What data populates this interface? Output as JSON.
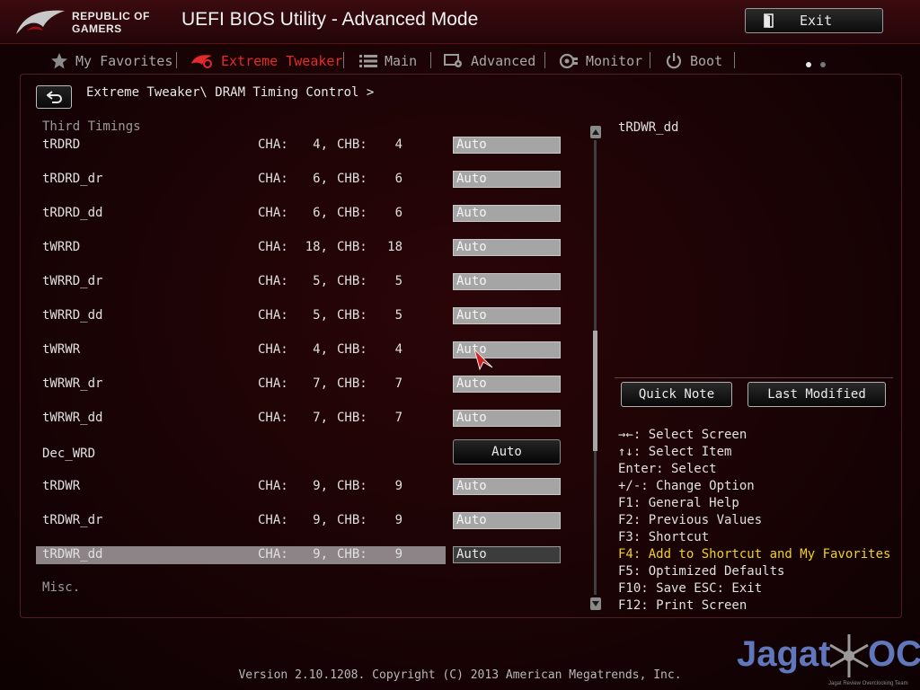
{
  "header": {
    "logo_line1": "REPUBLIC OF",
    "logo_line2": "GAMERS",
    "title": "UEFI BIOS Utility - Advanced Mode",
    "exit_label": "Exit"
  },
  "tabs": [
    {
      "label": "My Favorites",
      "icon": "star-icon",
      "active": false
    },
    {
      "label": "Extreme Tweaker",
      "icon": "tweaker-icon",
      "active": true
    },
    {
      "label": "Main",
      "icon": "list-icon",
      "active": false
    },
    {
      "label": "Advanced",
      "icon": "advanced-icon",
      "active": false
    },
    {
      "label": "Monitor",
      "icon": "monitor-icon",
      "active": false
    },
    {
      "label": "Boot",
      "icon": "power-icon",
      "active": false
    }
  ],
  "breadcrumb": "Extreme Tweaker\\ DRAM Timing Control >",
  "sections": {
    "third_timings": "Third Timings",
    "misc": "Misc."
  },
  "rows": [
    {
      "name": "tRDRD",
      "cha_label": "CHA:",
      "cha": "4,",
      "chb_label": "CHB:",
      "chb": "4",
      "value": "Auto"
    },
    {
      "name": "tRDRD_dr",
      "cha_label": "CHA:",
      "cha": "6,",
      "chb_label": "CHB:",
      "chb": "6",
      "value": "Auto"
    },
    {
      "name": "tRDRD_dd",
      "cha_label": "CHA:",
      "cha": "6,",
      "chb_label": "CHB:",
      "chb": "6",
      "value": "Auto"
    },
    {
      "name": "tWRRD",
      "cha_label": "CHA:",
      "cha": "18,",
      "chb_label": "CHB:",
      "chb": "18",
      "value": "Auto"
    },
    {
      "name": "tWRRD_dr",
      "cha_label": "CHA:",
      "cha": "5,",
      "chb_label": "CHB:",
      "chb": "5",
      "value": "Auto"
    },
    {
      "name": "tWRRD_dd",
      "cha_label": "CHA:",
      "cha": "5,",
      "chb_label": "CHB:",
      "chb": "5",
      "value": "Auto"
    },
    {
      "name": "tWRWR",
      "cha_label": "CHA:",
      "cha": "4,",
      "chb_label": "CHB:",
      "chb": "4",
      "value": "Auto"
    },
    {
      "name": "tWRWR_dr",
      "cha_label": "CHA:",
      "cha": "7,",
      "chb_label": "CHB:",
      "chb": "7",
      "value": "Auto"
    },
    {
      "name": "tWRWR_dd",
      "cha_label": "CHA:",
      "cha": "7,",
      "chb_label": "CHB:",
      "chb": "7",
      "value": "Auto"
    },
    {
      "name": "Dec_WRD",
      "value": "Auto"
    },
    {
      "name": "tRDWR",
      "cha_label": "CHA:",
      "cha": "9,",
      "chb_label": "CHB:",
      "chb": "9",
      "value": "Auto"
    },
    {
      "name": "tRDWR_dr",
      "cha_label": "CHA:",
      "cha": "9,",
      "chb_label": "CHB:",
      "chb": "9",
      "value": "Auto"
    },
    {
      "name": "tRDWR_dd",
      "cha_label": "CHA:",
      "cha": "9,",
      "chb_label": "CHB:",
      "chb": "9",
      "value": "Auto",
      "selected": true
    }
  ],
  "help": {
    "title": "tRDWR_dd",
    "quick_note": "Quick Note",
    "last_modified": "Last Modified"
  },
  "keys": [
    "→←: Select Screen",
    "↑↓: Select Item",
    "Enter: Select",
    "+/-: Change Option",
    "F1: General Help",
    "F2: Previous Values",
    "F3: Shortcut",
    "F4: Add to Shortcut and My Favorites",
    "F5: Optimized Defaults",
    "F10: Save  ESC: Exit",
    "F12: Print Screen"
  ],
  "footer": "Version 2.10.1208. Copyright (C) 2013 American Megatrends, Inc.",
  "watermark": {
    "left": "Jagat",
    "right": "OC",
    "sub": "Jagat Review Overclocking Team"
  },
  "colors": {
    "accent": "#e52a2a",
    "highlight_key": "#f0d21e",
    "selected_row": "#8d8487"
  }
}
